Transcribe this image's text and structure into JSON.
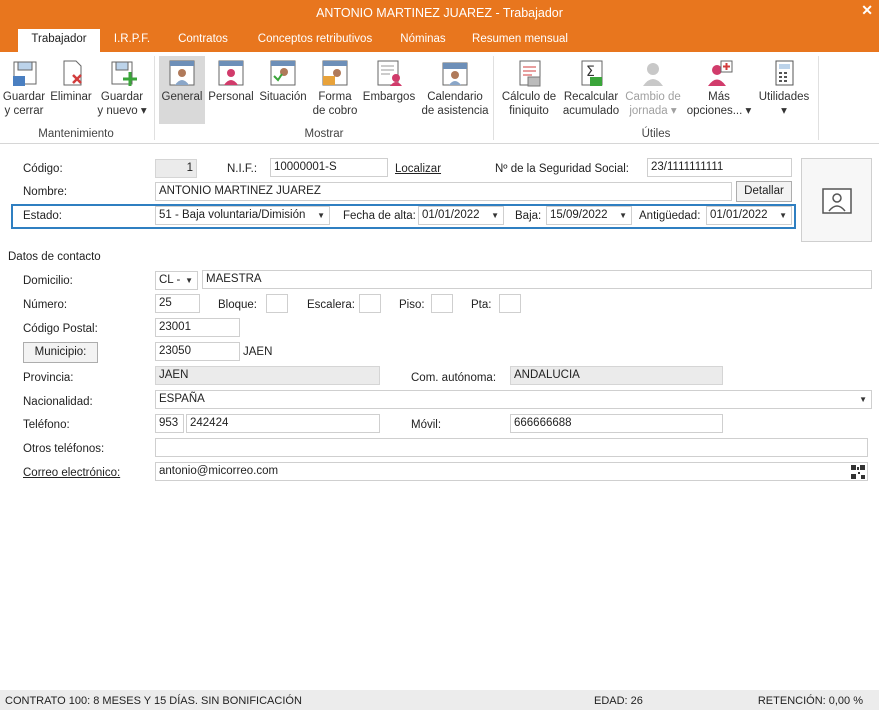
{
  "window": {
    "title": "ANTONIO MARTINEZ JUAREZ - Trabajador"
  },
  "tabs": [
    "Trabajador",
    "I.R.P.F.",
    "Contratos",
    "Conceptos retributivos",
    "Nóminas",
    "Resumen mensual"
  ],
  "ribbon": {
    "mantenimiento": {
      "label": "Mantenimiento",
      "guardar1": "Guardar",
      "guardar2": "y cerrar",
      "eliminar": "Eliminar",
      "nuevo1": "Guardar",
      "nuevo2": "y nuevo ▾"
    },
    "mostrar": {
      "label": "Mostrar",
      "general": "General",
      "personal": "Personal",
      "situacion": "Situación",
      "forma1": "Forma",
      "forma2": "de cobro",
      "embargos": "Embargos",
      "cal1": "Calendario",
      "cal2": "de asistencia"
    },
    "utiles": {
      "label": "Útiles",
      "calc1": "Cálculo de",
      "calc2": "finiquito",
      "recalc1": "Recalcular",
      "recalc2": "acumulado",
      "cambio1": "Cambio de",
      "cambio2": "jornada ▾",
      "mas1": "Más",
      "mas2": "opciones... ▾",
      "util1": "Utilidades",
      "util2": "▾"
    }
  },
  "form": {
    "codigo_label": "Código:",
    "codigo": "1",
    "nif_label": "N.I.F.:",
    "nif": "10000001-S",
    "localizar": "Localizar",
    "nss_label": "Nº de la Seguridad Social:",
    "nss": "23/1111111111",
    "nombre_label": "Nombre:",
    "nombre": "ANTONIO MARTINEZ JUAREZ",
    "detallar": "Detallar",
    "estado_label": "Estado:",
    "estado": "51 - Baja voluntaria/Dimisión",
    "alta_label": "Fecha de alta:",
    "alta": "01/01/2022",
    "baja_label": "Baja:",
    "baja": "15/09/2022",
    "antig_label": "Antigüedad:",
    "antig": "01/01/2022"
  },
  "contacto": {
    "title": "Datos de contacto",
    "domicilio_label": "Domicilio:",
    "via": "CL -",
    "domicilio": "MAESTRA",
    "numero_label": "Número:",
    "numero": "25",
    "bloque_label": "Bloque:",
    "escalera_label": "Escalera:",
    "piso_label": "Piso:",
    "pta_label": "Pta:",
    "cp_label": "Código Postal:",
    "cp": "23001",
    "municipio_btn": "Municipio:",
    "municipio_code": "23050",
    "municipio": "JAEN",
    "provincia_label": "Provincia:",
    "provincia": "JAEN",
    "comaut_label": "Com. autónoma:",
    "comaut": "ANDALUCIA",
    "nacionalidad_label": "Nacionalidad:",
    "nacionalidad": "ESPAÑA",
    "telefono_label": "Teléfono:",
    "prefijo": "953",
    "telefono": "242424",
    "movil_label": "Móvil:",
    "movil": "666666688",
    "otros_label": "Otros teléfonos:",
    "otros": "",
    "email_label": "Correo electrónico:",
    "email": "antonio@micorreo.com"
  },
  "status": {
    "contrato": "CONTRATO 100: 8 MESES Y 15 DÍAS.  SIN BONIFICACIÓN",
    "edad": "EDAD: 26",
    "retencion": "RETENCIÓN: 0,00 %"
  }
}
